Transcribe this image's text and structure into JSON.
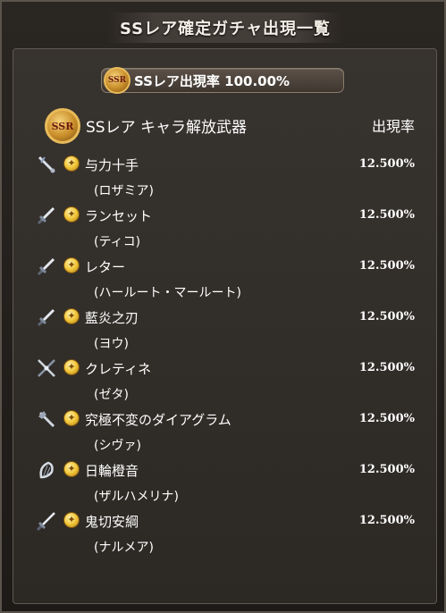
{
  "window": {
    "title": "SSレア確定ガチャ出現一覧"
  },
  "summary": {
    "badge": "SSR",
    "rate_text": "SSレア出現率 100.00%"
  },
  "section": {
    "badge": "SSR",
    "title": "SSレア キャラ解放武器",
    "rate_header": "出現率"
  },
  "colors": {
    "background": "#2c2925",
    "text": "#ffffff",
    "accent_gold": "#e8bb5a"
  },
  "items": [
    {
      "weapon": "与力十手",
      "character": "(ロザミア)",
      "rate": "12.500%",
      "icon": "jitte-weapon-icon"
    },
    {
      "weapon": "ランセット",
      "character": "(ティコ)",
      "rate": "12.500%",
      "icon": "dagger-weapon-icon"
    },
    {
      "weapon": "レター",
      "character": "(ハールート・マールート)",
      "rate": "12.500%",
      "icon": "dagger-weapon-icon"
    },
    {
      "weapon": "藍炎之刃",
      "character": "(ヨウ)",
      "rate": "12.500%",
      "icon": "dagger-weapon-icon"
    },
    {
      "weapon": "クレティネ",
      "character": "(ゼタ)",
      "rate": "12.500%",
      "icon": "spear-weapon-icon"
    },
    {
      "weapon": "究極不変のダイアグラム",
      "character": "(シヴァ)",
      "rate": "12.500%",
      "icon": "axe-weapon-icon"
    },
    {
      "weapon": "日輪橙音",
      "character": "(ザルハメリナ)",
      "rate": "12.500%",
      "icon": "harp-weapon-icon"
    },
    {
      "weapon": "鬼切安綱",
      "character": "(ナルメア)",
      "rate": "12.500%",
      "icon": "katana-weapon-icon"
    }
  ]
}
